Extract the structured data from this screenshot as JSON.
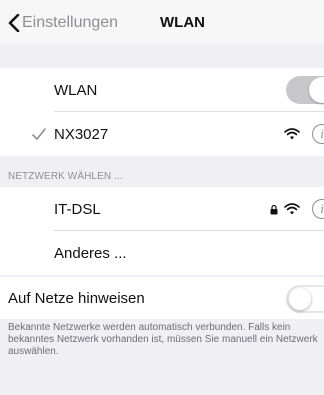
{
  "navbar": {
    "back_label": "Einstellungen",
    "title": "WLAN"
  },
  "wlan_toggle": {
    "label": "WLAN",
    "state": "on"
  },
  "connected_network": {
    "name": "NX3027",
    "icons": [
      "checkmark-icon",
      "wifi-icon",
      "info-icon"
    ]
  },
  "networks_section": {
    "header": "NETZWERK WÄHLEN ...",
    "items": [
      {
        "name": "IT-DSL",
        "icons": [
          "lock-icon",
          "wifi-icon",
          "info-icon"
        ]
      },
      {
        "name": "Anderes ..."
      }
    ]
  },
  "ask_to_join": {
    "label": "Auf Netze hinweisen",
    "state": "off",
    "footer": "Bekannte Netzwerke werden automatisch verbunden. Falls kein bekanntes Netzwerk vorhanden ist, müssen Sie manuell ein Netzwerk auswählen."
  },
  "colors": {
    "background": "#efeff4",
    "secondary_text": "#8e8e93",
    "toggle_on": "#c7c7cc"
  }
}
